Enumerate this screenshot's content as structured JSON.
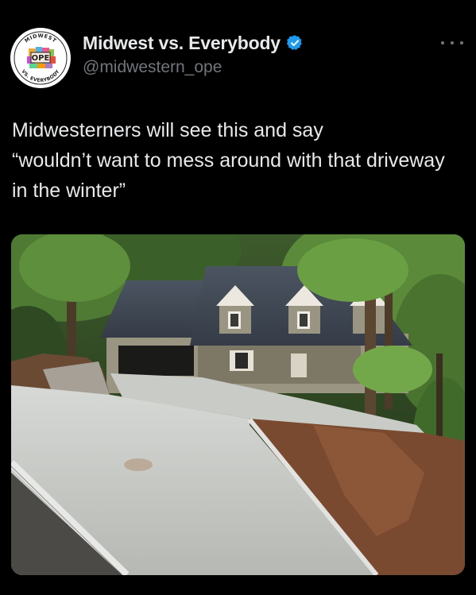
{
  "account": {
    "display_name": "Midwest vs. Everybody",
    "handle": "@midwestern_ope",
    "verified": true,
    "verified_color": "#1d9bf0"
  },
  "avatar_logo": {
    "top_text": "MIDWEST",
    "center_text": "OPE",
    "bottom_text": "VS. EVERYBODY"
  },
  "tweet": {
    "text": "Midwesterners will see this and say\n“wouldn’t want to mess around with that driveway in the winter”"
  },
  "media": {
    "icon": "photo"
  },
  "theme": {
    "background": "#000000",
    "text": "#e7e9ea",
    "secondary_text": "#71767b"
  }
}
